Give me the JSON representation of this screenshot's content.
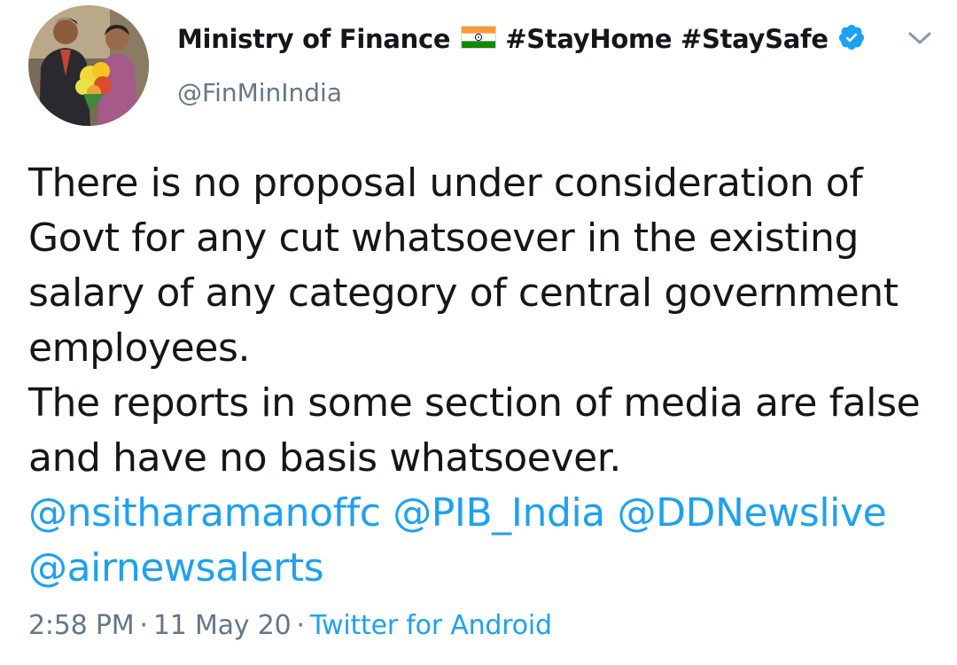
{
  "user": {
    "display_name": "Ministry of Finance",
    "flag_icon": "india-flag-icon",
    "hashtags": "#StayHome #StaySafe",
    "verified_icon": "verified-badge-icon",
    "handle": "@FinMinIndia"
  },
  "tweet": {
    "paragraph_1": "There is no proposal under consideration of Govt for any cut whatsoever in the existing salary of any category of central government employees.",
    "paragraph_2": "The reports in some section of media are false and have no basis whatsoever.",
    "mentions": [
      "@nsitharamanoffc",
      "@PIB_India",
      "@DDNewslive",
      "@airnewsalerts"
    ]
  },
  "meta": {
    "time": "2:58 PM",
    "separator": "·",
    "date": "11 May 20",
    "source": "Twitter for Android"
  },
  "colors": {
    "link": "#1da1f2",
    "secondary_text": "#657786",
    "primary_text": "#14171a",
    "verified": "#1da1f2"
  }
}
